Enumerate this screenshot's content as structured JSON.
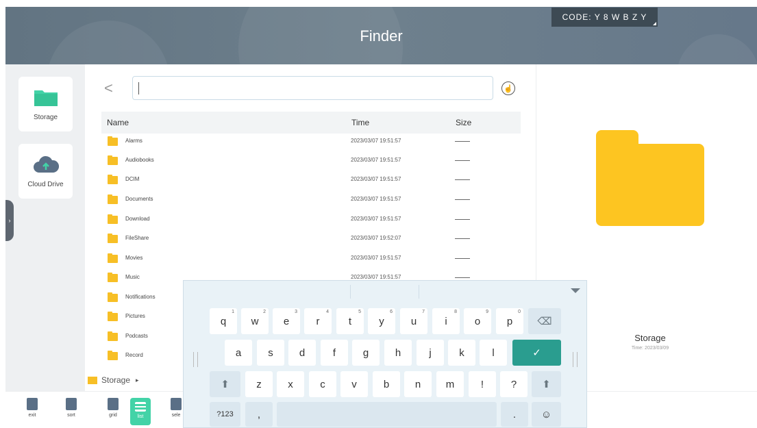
{
  "header": {
    "title": "Finder",
    "code": "CODE: Y 8 W B Z Y"
  },
  "sidebar": {
    "items": [
      {
        "label": "Storage",
        "icon": "folder-icon"
      },
      {
        "label": "Cloud Drive",
        "icon": "cloud-upload-icon"
      }
    ],
    "expand_glyph": "›"
  },
  "toolbar": {
    "back_glyph": "<",
    "search_value": "",
    "search_icon": "touch-icon"
  },
  "table": {
    "columns": [
      "Name",
      "Time",
      "Size"
    ],
    "rows": [
      {
        "name": "Alarms",
        "time": "2023/03/07 19:51:57"
      },
      {
        "name": "Audiobooks",
        "time": "2023/03/07 19:51:57"
      },
      {
        "name": "DCIM",
        "time": "2023/03/07 19:51:57"
      },
      {
        "name": "Documents",
        "time": "2023/03/07 19:51:57"
      },
      {
        "name": "Download",
        "time": "2023/03/07 19:51:57"
      },
      {
        "name": "FileShare",
        "time": "2023/03/07 19:52:07"
      },
      {
        "name": "Movies",
        "time": "2023/03/07 19:51:57"
      },
      {
        "name": "Music",
        "time": "2023/03/07 19:51:57"
      },
      {
        "name": "Notifications",
        "time": ""
      },
      {
        "name": "Pictures",
        "time": ""
      },
      {
        "name": "Podcasts",
        "time": ""
      },
      {
        "name": "Record",
        "time": ""
      }
    ]
  },
  "breadcrumb": {
    "label": "Storage",
    "arrow": "▸"
  },
  "preview": {
    "name": "Storage",
    "time": "Time: 2023/03/09"
  },
  "bottom_tools": [
    {
      "label": "exit"
    },
    {
      "label": "sort"
    },
    {
      "label": "grid"
    },
    {
      "label": "list",
      "active": true
    },
    {
      "label": "sele"
    }
  ],
  "keyboard": {
    "row1": [
      {
        "k": "q",
        "n": "1"
      },
      {
        "k": "w",
        "n": "2"
      },
      {
        "k": "e",
        "n": "3"
      },
      {
        "k": "r",
        "n": "4"
      },
      {
        "k": "t",
        "n": "5"
      },
      {
        "k": "y",
        "n": "6"
      },
      {
        "k": "u",
        "n": "7"
      },
      {
        "k": "i",
        "n": "8"
      },
      {
        "k": "o",
        "n": "9"
      },
      {
        "k": "p",
        "n": "0"
      }
    ],
    "row2": [
      "a",
      "s",
      "d",
      "f",
      "g",
      "h",
      "j",
      "k",
      "l"
    ],
    "row3": [
      "z",
      "x",
      "c",
      "v",
      "b",
      "n",
      "m",
      "!",
      "?"
    ],
    "backspace": "⌫",
    "enter": "✓",
    "shift": "⬆",
    "mode": "?123",
    "comma": ",",
    "period": ".",
    "emoji": "☺"
  },
  "colors": {
    "accent": "#43d3a7",
    "folder": "#fdc521",
    "header": "#6b7d8a",
    "enter": "#2a9d8f"
  }
}
